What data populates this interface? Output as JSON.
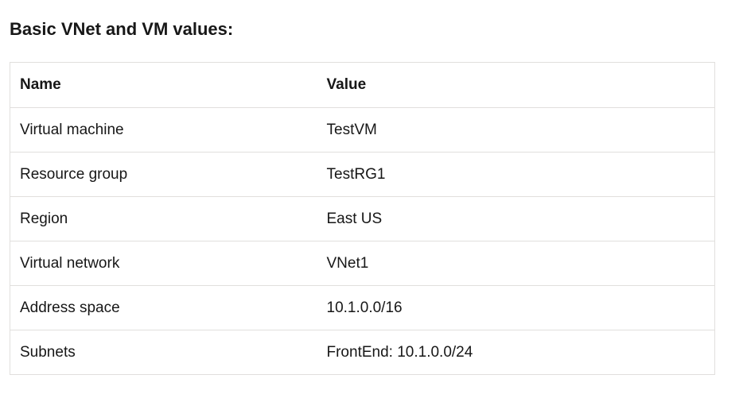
{
  "heading": "Basic VNet and VM values:",
  "table": {
    "headers": {
      "name": "Name",
      "value": "Value"
    },
    "rows": [
      {
        "name": "Virtual machine",
        "value": "TestVM"
      },
      {
        "name": "Resource group",
        "value": "TestRG1"
      },
      {
        "name": "Region",
        "value": "East US"
      },
      {
        "name": "Virtual network",
        "value": "VNet1"
      },
      {
        "name": "Address space",
        "value": "10.1.0.0/16"
      },
      {
        "name": "Subnets",
        "value": "FrontEnd: 10.1.0.0/24"
      }
    ]
  }
}
